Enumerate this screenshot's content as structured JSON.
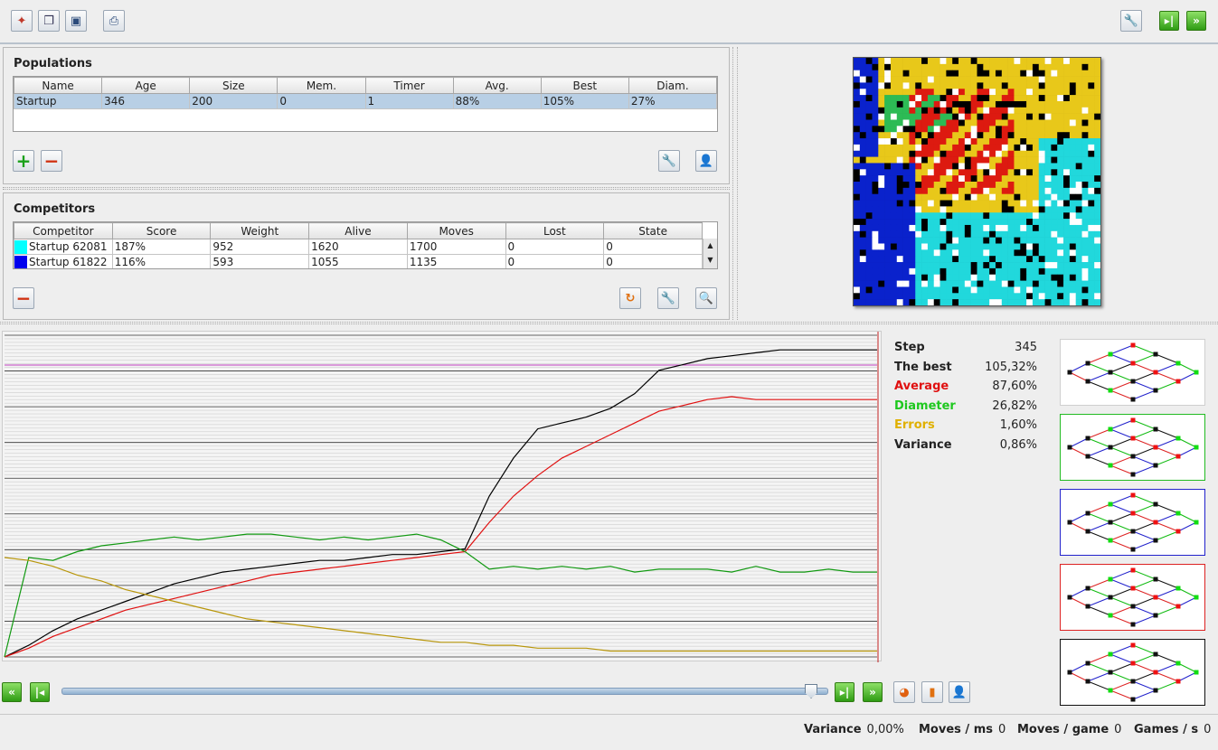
{
  "toolbar": {
    "left_icons": [
      "magic-wand-icon",
      "copy-icon",
      "save-icon",
      "print-icon"
    ],
    "right_icons": [
      "wrench-icon",
      "next-icon",
      "fast-forward-icon"
    ]
  },
  "populations": {
    "title": "Populations",
    "columns": [
      "Name",
      "Age",
      "Size",
      "Mem.",
      "Timer",
      "Avg.",
      "Best",
      "Diam."
    ],
    "rows": [
      [
        "Startup",
        "346",
        "200",
        "0",
        "1",
        "88%",
        "105%",
        "27%"
      ]
    ],
    "add_label": "+",
    "remove_label": "−"
  },
  "competitors": {
    "title": "Competitors",
    "columns": [
      "Competitor",
      "Score",
      "Weight",
      "Alive",
      "Moves",
      "Lost",
      "State"
    ],
    "rows": [
      {
        "color": "#00ffff",
        "cells": [
          "Startup 62081",
          "187%",
          "952",
          "1620",
          "1700",
          "0",
          "0"
        ]
      },
      {
        "color": "#0000ee",
        "cells": [
          "Startup 61822",
          "116%",
          "593",
          "1055",
          "1135",
          "0",
          "0"
        ]
      }
    ]
  },
  "stats": [
    {
      "label": "Step",
      "value": "345",
      "color": "#222222"
    },
    {
      "label": "The best",
      "value": "105,32%",
      "color": "#222222"
    },
    {
      "label": "Average",
      "value": "87,60%",
      "color": "#e01010"
    },
    {
      "label": "Diameter",
      "value": "26,82%",
      "color": "#1ec81e"
    },
    {
      "label": "Errors",
      "value": "1,60%",
      "color": "#e0b000"
    },
    {
      "label": "Variance",
      "value": "0,86%",
      "color": "#222222"
    }
  ],
  "mini_borders": [
    "#cfcfcf",
    "#22bb22",
    "#2222cc",
    "#dd2222",
    "#111111"
  ],
  "status": [
    {
      "label": "Variance",
      "value": "0,00%"
    },
    {
      "label": "Moves / ms",
      "value": "0"
    },
    {
      "label": "Moves / game",
      "value": "0"
    },
    {
      "label": "Games / s",
      "value": "0"
    }
  ],
  "slider": {
    "position": 0.98
  },
  "chart_data": {
    "type": "line",
    "x_range": [
      0,
      345
    ],
    "ylim": [
      0,
      1.1
    ],
    "grid": true,
    "series": [
      {
        "color": "#000000",
        "values": [
          0.0,
          0.04,
          0.09,
          0.13,
          0.16,
          0.19,
          0.22,
          0.25,
          0.27,
          0.29,
          0.3,
          0.31,
          0.32,
          0.33,
          0.33,
          0.34,
          0.35,
          0.35,
          0.36,
          0.37,
          0.55,
          0.68,
          0.78,
          0.8,
          0.82,
          0.85,
          0.9,
          0.98,
          1.0,
          1.02,
          1.03,
          1.04,
          1.05,
          1.05,
          1.05,
          1.05,
          1.05
        ]
      },
      {
        "color": "#e01010",
        "values": [
          0.0,
          0.03,
          0.07,
          0.1,
          0.13,
          0.16,
          0.18,
          0.2,
          0.22,
          0.24,
          0.26,
          0.28,
          0.29,
          0.3,
          0.31,
          0.32,
          0.33,
          0.34,
          0.35,
          0.36,
          0.46,
          0.55,
          0.62,
          0.68,
          0.72,
          0.76,
          0.8,
          0.84,
          0.86,
          0.88,
          0.89,
          0.88,
          0.88,
          0.88,
          0.88,
          0.88,
          0.88
        ]
      },
      {
        "color": "#119911",
        "values": [
          0.0,
          0.34,
          0.33,
          0.36,
          0.38,
          0.39,
          0.4,
          0.41,
          0.4,
          0.41,
          0.42,
          0.42,
          0.41,
          0.4,
          0.41,
          0.4,
          0.41,
          0.42,
          0.4,
          0.36,
          0.3,
          0.31,
          0.3,
          0.31,
          0.3,
          0.31,
          0.29,
          0.3,
          0.3,
          0.3,
          0.29,
          0.31,
          0.29,
          0.29,
          0.3,
          0.29,
          0.29
        ]
      },
      {
        "color": "#b8960a",
        "values": [
          0.34,
          0.33,
          0.31,
          0.28,
          0.26,
          0.23,
          0.21,
          0.19,
          0.17,
          0.15,
          0.13,
          0.12,
          0.11,
          0.1,
          0.09,
          0.08,
          0.07,
          0.06,
          0.05,
          0.05,
          0.04,
          0.04,
          0.03,
          0.03,
          0.03,
          0.02,
          0.02,
          0.02,
          0.02,
          0.02,
          0.02,
          0.02,
          0.02,
          0.02,
          0.02,
          0.02,
          0.02
        ]
      }
    ]
  }
}
